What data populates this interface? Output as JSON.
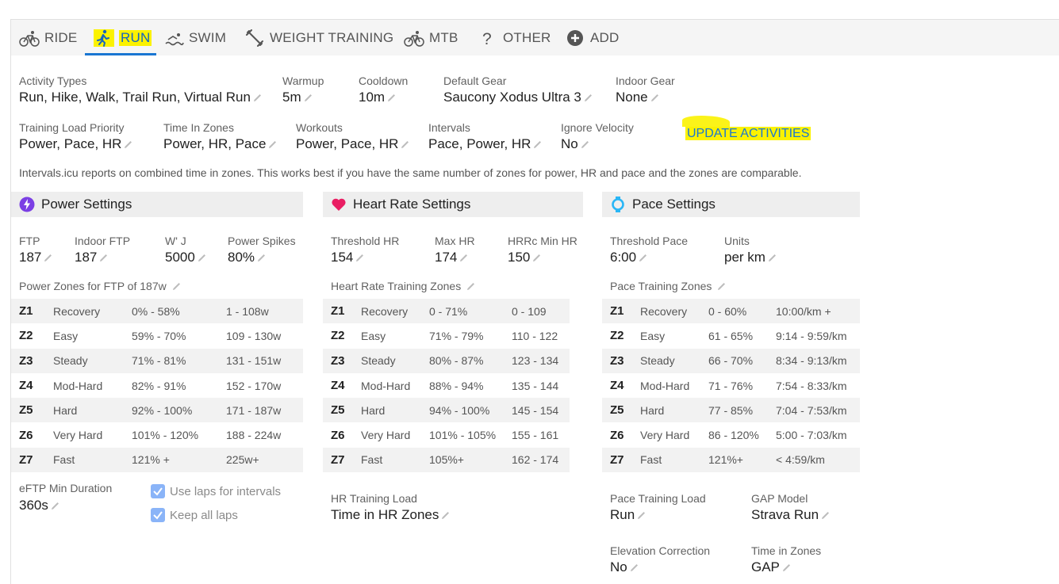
{
  "tabs": [
    {
      "label": "RIDE",
      "icon": "bike-icon"
    },
    {
      "label": "RUN",
      "icon": "run-icon"
    },
    {
      "label": "SWIM",
      "icon": "swim-icon"
    },
    {
      "label": "WEIGHT TRAINING",
      "icon": "dumbbell-icon"
    },
    {
      "label": "MTB",
      "icon": "mtb-icon"
    },
    {
      "label": "OTHER",
      "icon": "question-icon"
    },
    {
      "label": "ADD",
      "icon": "add-circle-icon"
    }
  ],
  "settings": {
    "activity_types": {
      "label": "Activity Types",
      "value": "Run, Hike, Walk, Trail Run, Virtual Run"
    },
    "warmup": {
      "label": "Warmup",
      "value": "5m"
    },
    "cooldown": {
      "label": "Cooldown",
      "value": "10m"
    },
    "default_gear": {
      "label": "Default Gear",
      "value": "Saucony Xodus Ultra 3"
    },
    "indoor_gear": {
      "label": "Indoor Gear",
      "value": "None"
    },
    "training_load_priority": {
      "label": "Training Load Priority",
      "value": "Power, Pace, HR"
    },
    "time_in_zones": {
      "label": "Time In Zones",
      "value": "Power, HR, Pace"
    },
    "workouts": {
      "label": "Workouts",
      "value": "Power, Pace, HR"
    },
    "intervals": {
      "label": "Intervals",
      "value": "Pace, Power, HR"
    },
    "ignore_velocity": {
      "label": "Ignore Velocity",
      "value": "No"
    },
    "update_button": "UPDATE ACTIVITIES",
    "note": "Intervals.icu reports on combined time in zones. This works best if you have the same number of zones for power, HR and pace and the zones are comparable."
  },
  "power": {
    "title": "Power Settings",
    "ftp": {
      "label": "FTP",
      "value": "187"
    },
    "indoor_ftp": {
      "label": "Indoor FTP",
      "value": "187"
    },
    "wj": {
      "label": "W' J",
      "value": "5000"
    },
    "spikes": {
      "label": "Power Spikes",
      "value": "80%"
    },
    "zones_title": "Power Zones for FTP of 187w",
    "zones": [
      {
        "z": "Z1",
        "name": "Recovery",
        "pct": "0% - 58%",
        "range": "1 - 108w"
      },
      {
        "z": "Z2",
        "name": "Easy",
        "pct": "59% - 70%",
        "range": "109 - 130w"
      },
      {
        "z": "Z3",
        "name": "Steady",
        "pct": "71% - 81%",
        "range": "131 - 151w"
      },
      {
        "z": "Z4",
        "name": "Mod-Hard",
        "pct": "82% - 91%",
        "range": "152 - 170w"
      },
      {
        "z": "Z5",
        "name": "Hard",
        "pct": "92% - 100%",
        "range": "171 - 187w"
      },
      {
        "z": "Z6",
        "name": "Very Hard",
        "pct": "101% - 120%",
        "range": "188 - 224w"
      },
      {
        "z": "Z7",
        "name": "Fast",
        "pct": "121% +",
        "range": "225w+"
      }
    ],
    "eftp": {
      "label": "eFTP Min Duration",
      "value": "360s"
    },
    "use_laps": "Use laps for intervals",
    "keep_laps": "Keep all laps"
  },
  "hr": {
    "title": "Heart Rate Settings",
    "threshold": {
      "label": "Threshold HR",
      "value": "154"
    },
    "max": {
      "label": "Max HR",
      "value": "174"
    },
    "hrrc": {
      "label": "HRRc Min HR",
      "value": "150"
    },
    "zones_title": "Heart Rate Training Zones",
    "zones": [
      {
        "z": "Z1",
        "name": "Recovery",
        "pct": "0 - 71%",
        "range": "0 - 109"
      },
      {
        "z": "Z2",
        "name": "Easy",
        "pct": "71% - 79%",
        "range": "110 - 122"
      },
      {
        "z": "Z3",
        "name": "Steady",
        "pct": "80% - 87%",
        "range": "123 - 134"
      },
      {
        "z": "Z4",
        "name": "Mod-Hard",
        "pct": "88% - 94%",
        "range": "135 - 144"
      },
      {
        "z": "Z5",
        "name": "Hard",
        "pct": "94% - 100%",
        "range": "145 - 154"
      },
      {
        "z": "Z6",
        "name": "Very Hard",
        "pct": "101% - 105%",
        "range": "155 - 161"
      },
      {
        "z": "Z7",
        "name": "Fast",
        "pct": "105%+",
        "range": "162 - 174"
      }
    ],
    "training_load": {
      "label": "HR Training Load",
      "value": "Time in HR Zones"
    }
  },
  "pace": {
    "title": "Pace Settings",
    "threshold": {
      "label": "Threshold Pace",
      "value": "6:00"
    },
    "units": {
      "label": "Units",
      "value": "per km"
    },
    "zones_title": "Pace Training Zones",
    "zones": [
      {
        "z": "Z1",
        "name": "Recovery",
        "pct": "0 - 60%",
        "range": "10:00/km +"
      },
      {
        "z": "Z2",
        "name": "Easy",
        "pct": "61 - 65%",
        "range": "9:14 - 9:59/km"
      },
      {
        "z": "Z3",
        "name": "Steady",
        "pct": "66 - 70%",
        "range": "8:34 - 9:13/km"
      },
      {
        "z": "Z4",
        "name": "Mod-Hard",
        "pct": "71 - 76%",
        "range": "7:54 - 8:33/km"
      },
      {
        "z": "Z5",
        "name": "Hard",
        "pct": "77 - 85%",
        "range": "7:04 - 7:53/km"
      },
      {
        "z": "Z6",
        "name": "Very Hard",
        "pct": "86 - 120%",
        "range": "5:00 - 7:03/km"
      },
      {
        "z": "Z7",
        "name": "Fast",
        "pct": "121%+",
        "range": "< 4:59/km"
      }
    ],
    "training_load": {
      "label": "Pace Training Load",
      "value": "Run"
    },
    "gap_model": {
      "label": "GAP Model",
      "value": "Strava Run"
    },
    "elevation": {
      "label": "Elevation Correction",
      "value": "No"
    },
    "time_in_zones": {
      "label": "Time in Zones",
      "value": "GAP"
    }
  },
  "colors": {
    "accent": "#1976d2",
    "highlight": "#fbf200",
    "power_icon": "#7b3fe4",
    "hr_icon": "#e91e63",
    "pace_icon": "#29b6f6"
  }
}
